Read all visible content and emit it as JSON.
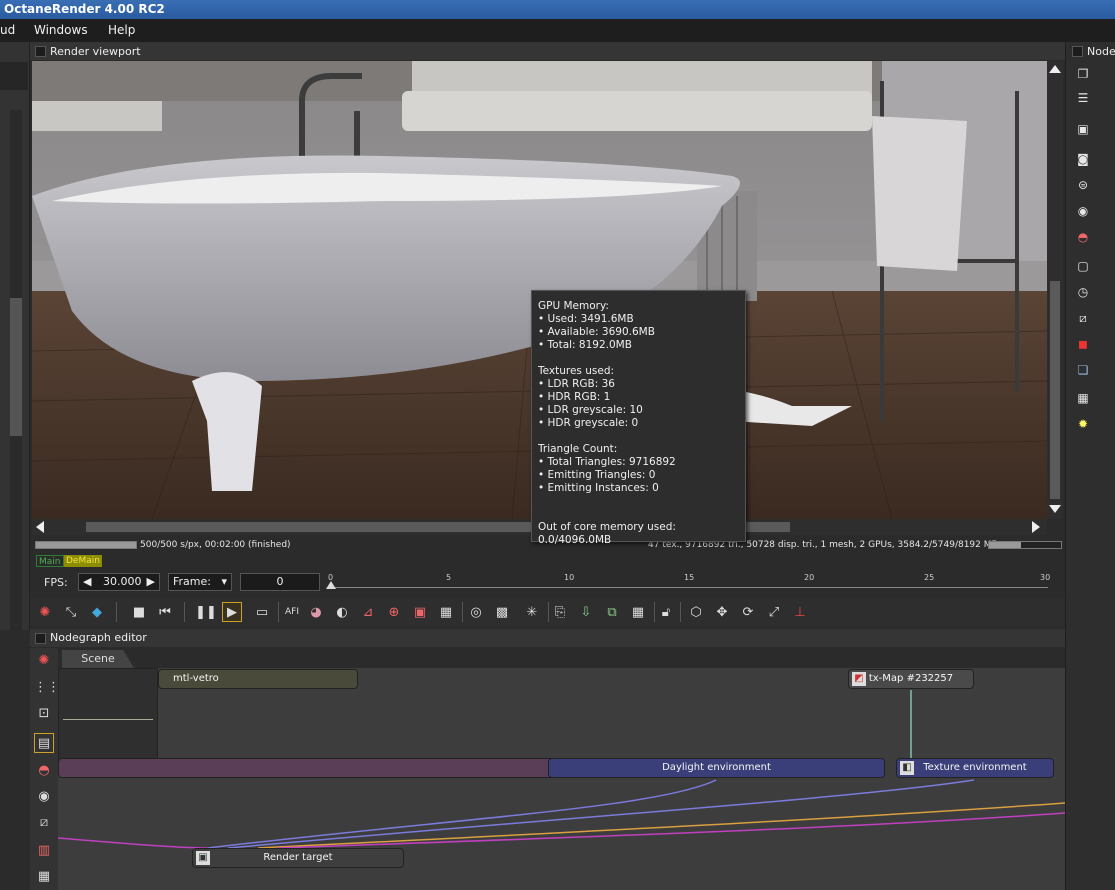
{
  "window": {
    "title": "OctaneRender 4.00 RC2"
  },
  "menu": {
    "items": [
      "ud",
      "Windows",
      "Help"
    ]
  },
  "viewport": {
    "title": "Render viewport",
    "progress_text": "500/500 s/px, 00:02:00 (finished)",
    "stats_text": "47 tex., 9716892 tri., 50728 disp. tri., 1 mesh, 2 GPUs, 3584.2/5749/8192 MB",
    "badge_main": "Main",
    "badge_demain": "DeMain",
    "render_progress": 1.0,
    "gpu_mem_fraction": 0.4375
  },
  "tooltip": {
    "gpu_heading": "GPU Memory:",
    "gpu_used": "• Used: 3491.6MB",
    "gpu_available": "• Available: 3690.6MB",
    "gpu_total": "• Total: 8192.0MB",
    "tex_heading": "Textures used:",
    "tex_ldr_rgb": "• LDR RGB: 36",
    "tex_hdr_rgb": "• HDR RGB: 1",
    "tex_ldr_grey": "• LDR greyscale: 10",
    "tex_hdr_grey": "• HDR greyscale: 0",
    "tri_heading": "Triangle Count:",
    "tri_total": "• Total Triangles: 9716892",
    "tri_emitting": "• Emitting Triangles: 0",
    "tri_instances": "• Emitting Instances: 0",
    "out_of_core": "Out of core memory used: 0.0/4096.0MB"
  },
  "playback": {
    "fps_label": "FPS:",
    "fps_value": "30.000",
    "frame_label": "Frame:",
    "frame_value": "0",
    "timeline_ticks": [
      "0",
      "5",
      "10",
      "15",
      "20",
      "25",
      "30"
    ]
  },
  "toolbar": {
    "icons": [
      "reset-camera-icon",
      "fit-icon",
      "color-cube-icon",
      "stop-icon",
      "restart-icon",
      "pause-icon",
      "play-icon",
      "monitor-icon",
      "afi-icon",
      "color-picker-icon",
      "material-picker-icon",
      "object-picker-icon",
      "camera-target-icon",
      "render-region-icon",
      "film-region-icon",
      "lock-viewport-icon",
      "clay-mode-icon",
      "subsample-icon",
      "copy-icon",
      "save-icon",
      "export-icon",
      "grid-icon",
      "lock-icon",
      "gizmo-cube-icon",
      "move-icon",
      "rotate-icon",
      "scale-icon",
      "axis-icon"
    ],
    "afi_label": "AFI"
  },
  "nodegraph": {
    "title": "Nodegraph editor",
    "tab": "Scene",
    "nodes": {
      "mtl_vetro": "mtl-vetro",
      "tx_map": "tx-Map #232257",
      "daylight": "Daylight environment",
      "texture_env": "Texture environment",
      "render_target": "Render target"
    }
  },
  "right_panel": {
    "title": "Node"
  },
  "colors": {
    "accent": "#3a6fb5",
    "badge_main": "#2e7d32",
    "badge_demain": "#8d8d00",
    "wire_blue": "#7b7bdc",
    "wire_orange": "#d9a040",
    "wire_magenta": "#c040c0"
  }
}
